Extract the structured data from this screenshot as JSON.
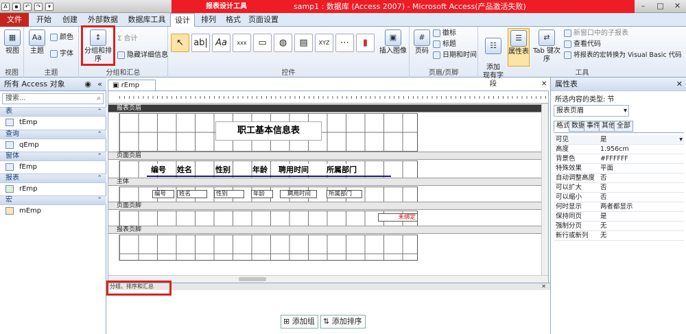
{
  "window": {
    "title": "samp1 : 数据库 (Access 2007) - Microsoft Access(产品激活失败)",
    "context_tab": "报表设计工具",
    "controls": [
      "–",
      "□",
      "✕"
    ]
  },
  "tabs": [
    {
      "label": "文件"
    },
    {
      "label": "开始"
    },
    {
      "label": "创建"
    },
    {
      "label": "外部数据"
    },
    {
      "label": "数据库工具"
    },
    {
      "label": "设计"
    },
    {
      "label": "排列"
    },
    {
      "label": "格式"
    },
    {
      "label": "页面设置"
    }
  ],
  "ribbon": {
    "view": {
      "label": "视图",
      "group": "视图"
    },
    "theme": {
      "theme_label": "主题",
      "colors": "颜色",
      "fonts": "字体",
      "group": "主题"
    },
    "grouping": {
      "group_sort": "分组和排序",
      "totals": "合计",
      "hide_details": "隐藏详细信息",
      "group": "分组和汇总"
    },
    "controls": {
      "group": "控件",
      "insert_image": "插入图像"
    },
    "header": {
      "page_number": "页码",
      "logo": "徽标",
      "title": "标题",
      "datetime": "日期和时间",
      "group": "页眉/页脚"
    },
    "tools": {
      "add_fields": "添加\n现有字段",
      "property_sheet": "属性表",
      "tab_order": "Tab 键次序",
      "subreport": "新窗口中的子报表",
      "view_code": "查看代码",
      "convert_vba": "将报表的宏转换为 Visual Basic 代码",
      "group": "工具"
    }
  },
  "nav": {
    "header": "所有 Access 对象",
    "search": "搜索...",
    "groups": [
      {
        "label": "表",
        "items": [
          "tEmp"
        ]
      },
      {
        "label": "查询",
        "items": [
          "qEmp"
        ]
      },
      {
        "label": "窗体",
        "items": [
          "fEmp"
        ]
      },
      {
        "label": "报表",
        "items": [
          "rEmp"
        ]
      },
      {
        "label": "宏",
        "items": [
          "mEmp"
        ]
      }
    ]
  },
  "doc": {
    "tab": "rEmp",
    "sections": {
      "report_header": "报表页眉",
      "page_header": "页面页眉",
      "detail": "主体",
      "page_footer": "页面页脚",
      "report_footer": "报表页脚"
    },
    "report_title": "职工基本信息表",
    "headers": [
      "编号",
      "姓名",
      "性别",
      "年龄",
      "聘用时间",
      "所属部门"
    ],
    "fields": [
      "编号",
      "姓名",
      "性别",
      "年龄",
      "聘用时间",
      "所属部门"
    ],
    "unbound": "未绑定"
  },
  "props": {
    "title": "属性表",
    "selection_label": "所选内容的类型: 节",
    "selected": "报表页眉",
    "tabs": [
      "格式",
      "数据",
      "事件",
      "其他",
      "全部"
    ],
    "rows": [
      {
        "k": "可见",
        "v": "是"
      },
      {
        "k": "高度",
        "v": "1.956cm"
      },
      {
        "k": "背景色",
        "v": "#FFFFFF"
      },
      {
        "k": "特殊效果",
        "v": "平面"
      },
      {
        "k": "自动调整高度",
        "v": "否"
      },
      {
        "k": "可以扩大",
        "v": "否"
      },
      {
        "k": "可以缩小",
        "v": "否"
      },
      {
        "k": "何时显示",
        "v": "两者都显示"
      },
      {
        "k": "保持同页",
        "v": "是"
      },
      {
        "k": "强制分页",
        "v": "无"
      },
      {
        "k": "新行或新列",
        "v": "无"
      }
    ]
  },
  "group_panel": {
    "title": "分组、排序和汇总",
    "add_group": "添加组",
    "add_sort": "添加排序"
  }
}
